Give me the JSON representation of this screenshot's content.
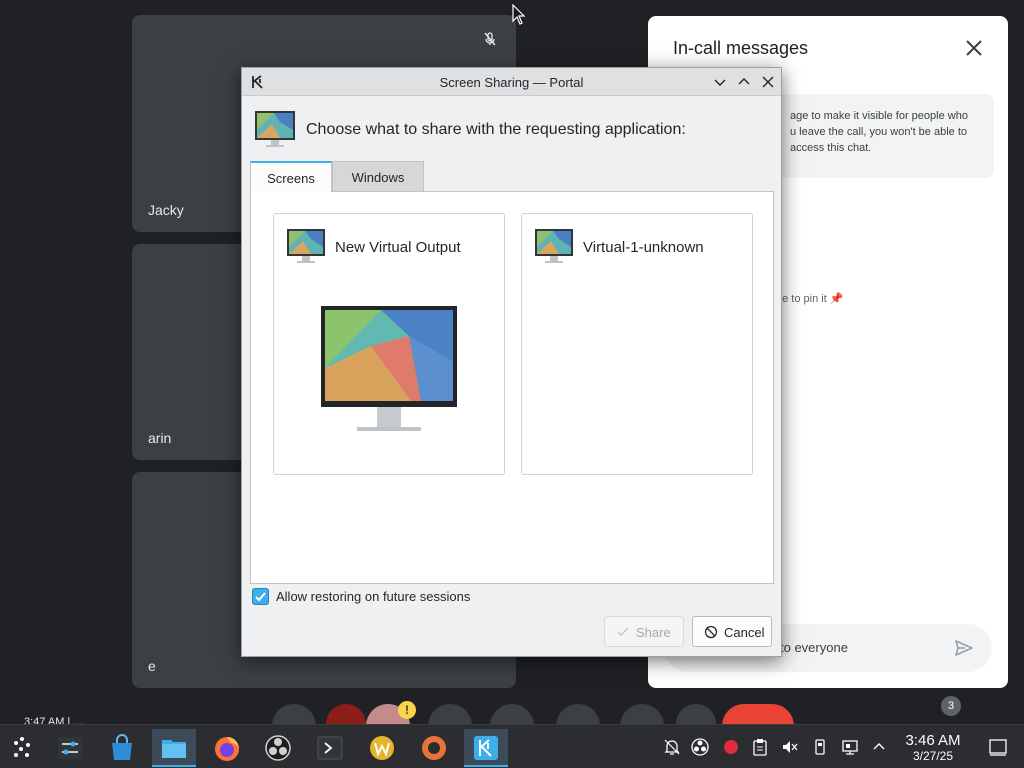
{
  "meet": {
    "tiles": [
      {
        "name": "Jacky"
      },
      {
        "name": "arin"
      },
      {
        "name": "e"
      }
    ],
    "panel": {
      "title": "In-call messages",
      "info_lines": [
        "age to make it visible for people who",
        "u leave the call, you won't be able to",
        "access this chat."
      ],
      "pin_hint": "ge to pin it",
      "input_placeholder": "to everyone"
    },
    "participants_badge": "3",
    "strip_text": "3:47 AM  |  ...",
    "warning_glyph": "!"
  },
  "dialog": {
    "title": "Screen Sharing — Portal",
    "header": "Choose what to share with the requesting application:",
    "tabs": [
      {
        "label": "Screens",
        "active": true
      },
      {
        "label": "Windows",
        "active": false
      }
    ],
    "screens": [
      {
        "label": "New Virtual Output"
      },
      {
        "label": "Virtual-1-unknown"
      }
    ],
    "allow_restore": {
      "label": "Allow restoring on future sessions",
      "checked": true
    },
    "buttons": {
      "share": "Share",
      "cancel": "Cancel"
    }
  },
  "taskbar": {
    "clock_time": "3:46 AM",
    "clock_date": "3/27/25"
  },
  "colors": {
    "accent": "#3daee9",
    "meet_bg": "#202124",
    "tile_bg": "#3c4043",
    "end_call_red": "#ea4335"
  }
}
